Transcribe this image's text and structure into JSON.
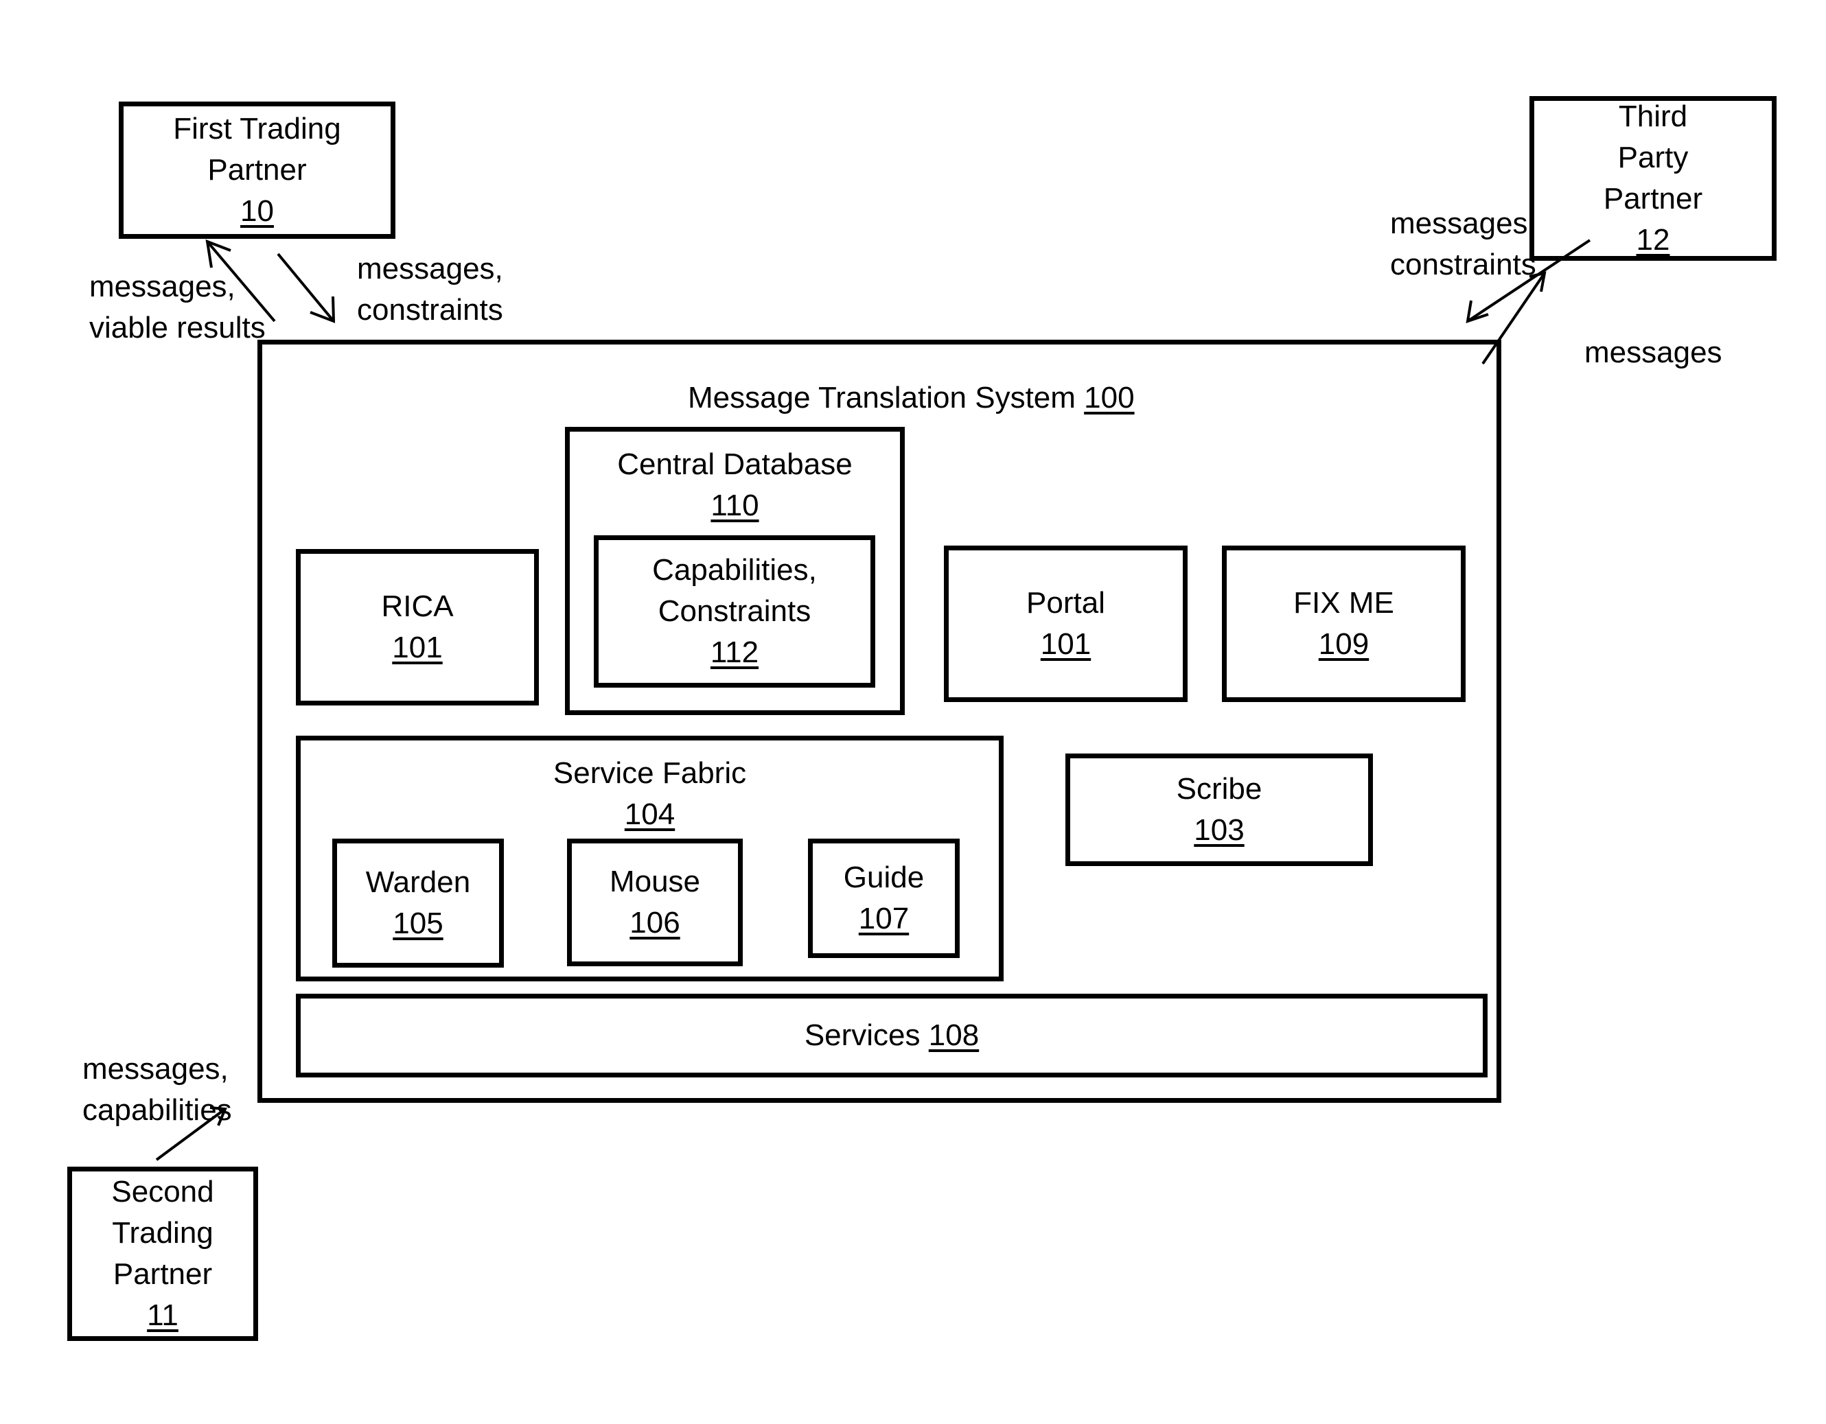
{
  "diagram": {
    "external": {
      "first_trading_partner": {
        "lines": [
          "First Trading",
          "Partner"
        ],
        "ref": "10"
      },
      "third_party_partner": {
        "lines": [
          "Third",
          "Party",
          "Partner"
        ],
        "ref": "12"
      },
      "second_trading_partner": {
        "lines": [
          "Second",
          "Trading",
          "Partner"
        ],
        "ref": "11"
      }
    },
    "system": {
      "title": "Message Translation System",
      "ref": "100"
    },
    "components": {
      "central_database": {
        "label": "Central Database",
        "ref": "110"
      },
      "capabilities_constraints": {
        "lines": [
          "Capabilities,",
          "Constraints"
        ],
        "ref": "112"
      },
      "rica": {
        "label": "RICA",
        "ref": "101"
      },
      "portal": {
        "label": "Portal",
        "ref": "101"
      },
      "fix_me": {
        "label": "FIX ME",
        "ref": "109"
      },
      "service_fabric": {
        "label": "Service Fabric",
        "ref": "104"
      },
      "warden": {
        "label": "Warden",
        "ref": "105"
      },
      "mouse": {
        "label": "Mouse",
        "ref": "106"
      },
      "guide": {
        "label": "Guide",
        "ref": "107"
      },
      "scribe": {
        "label": "Scribe",
        "ref": "103"
      },
      "services": {
        "label": "Services",
        "ref": "108"
      }
    },
    "flows": {
      "first_to_system": {
        "lines": [
          "messages,",
          "constraints"
        ]
      },
      "system_to_first": {
        "lines": [
          "messages,",
          "viable results"
        ]
      },
      "system_to_third": {
        "lines": [
          "messages"
        ]
      },
      "third_to_system": {
        "lines": [
          "messages,",
          "constraints"
        ]
      },
      "second_to_system": {
        "lines": [
          "messages,",
          "capabilities"
        ]
      }
    }
  }
}
